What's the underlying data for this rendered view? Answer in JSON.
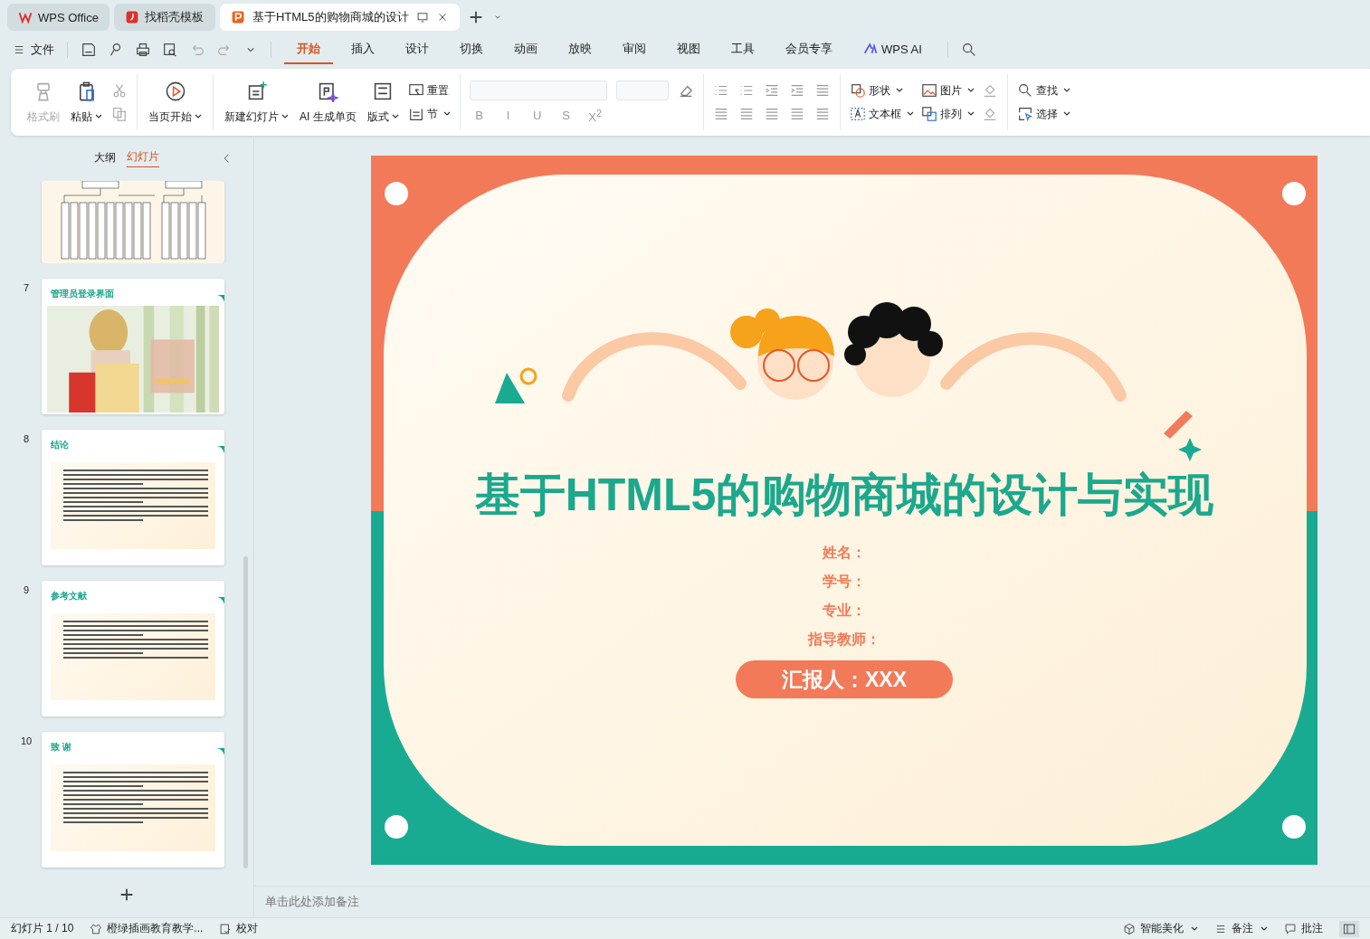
{
  "browser_tabs": [
    {
      "label": "WPS Office",
      "selected": false,
      "kind": "wps"
    },
    {
      "label": "找稻壳模板",
      "selected": false,
      "kind": "docer"
    },
    {
      "label": "基于HTML5的购物商城的设计",
      "selected": true,
      "kind": "ppt"
    }
  ],
  "menu": {
    "file": "文件",
    "tabs": [
      {
        "label": "开始",
        "selected": true,
        "kind": "tab"
      },
      {
        "label": "插入",
        "selected": false,
        "kind": "tab"
      },
      {
        "label": "设计",
        "selected": false,
        "kind": "tab"
      },
      {
        "label": "切换",
        "selected": false,
        "kind": "tab"
      },
      {
        "label": "动画",
        "selected": false,
        "kind": "tab"
      },
      {
        "label": "放映",
        "selected": false,
        "kind": "tab"
      },
      {
        "label": "审阅",
        "selected": false,
        "kind": "tab"
      },
      {
        "label": "视图",
        "selected": false,
        "kind": "tab"
      },
      {
        "label": "工具",
        "selected": false,
        "kind": "tab"
      },
      {
        "label": "会员专享",
        "selected": false,
        "kind": "tab"
      },
      {
        "label": "WPS AI",
        "selected": false,
        "kind": "ai"
      }
    ]
  },
  "ribbon": {
    "large": [
      {
        "label": "格式刷",
        "disabled": true,
        "dropdown": false
      },
      {
        "label": "粘贴",
        "disabled": false,
        "dropdown": true
      },
      {
        "label": "当页开始",
        "disabled": false,
        "dropdown": true
      },
      {
        "label": "新建幻灯片",
        "disabled": false,
        "dropdown": true
      },
      {
        "label": "AI 生成单页",
        "disabled": false,
        "dropdown": false
      },
      {
        "label": "版式",
        "disabled": false,
        "dropdown": true
      }
    ],
    "small": [
      {
        "label": "重置",
        "dropdown": false
      },
      {
        "label": "节",
        "dropdown": true
      },
      {
        "label": "形状",
        "dropdown": true
      },
      {
        "label": "文本框",
        "dropdown": true
      },
      {
        "label": "图片",
        "dropdown": true
      },
      {
        "label": "排列",
        "dropdown": true
      },
      {
        "label": "查找",
        "dropdown": true
      },
      {
        "label": "选择",
        "dropdown": true
      }
    ],
    "font_tools": [
      {
        "label": "B",
        "disabled": true
      },
      {
        "label": "I",
        "disabled": true
      },
      {
        "label": "U",
        "disabled": true
      },
      {
        "label": "S",
        "disabled": true
      },
      {
        "label": "X$^{2}$",
        "disabled": true
      }
    ]
  },
  "panel": {
    "tabs": [
      {
        "label": "大纲",
        "selected": false
      },
      {
        "label": "幻灯片",
        "selected": true
      }
    ],
    "slides": [
      {
        "kind": "diagram"
      },
      {
        "number": "7",
        "title": "管理员登录界面"
      },
      {
        "number": "8",
        "title": "结论",
        "kind": "text"
      },
      {
        "number": "9",
        "title": "参考文献",
        "kind": "list"
      },
      {
        "number": "10",
        "title": "致 谢",
        "kind": "text"
      }
    ]
  },
  "slide": {
    "title": "基于HTML5的购物商城的设计与实现",
    "fields": [
      "姓名：",
      "学号：",
      "专业：",
      "指导教师："
    ],
    "presenter": "汇报人：XXX"
  },
  "notes": {
    "placeholder": "单击此处添加备注"
  },
  "status_bar": {
    "slide": "幻灯片 1 / 10",
    "theme": "橙绿插画教育教学...",
    "proofing": "校对",
    "beautify": "智能美化",
    "notes": "备注",
    "comments": "批注"
  }
}
